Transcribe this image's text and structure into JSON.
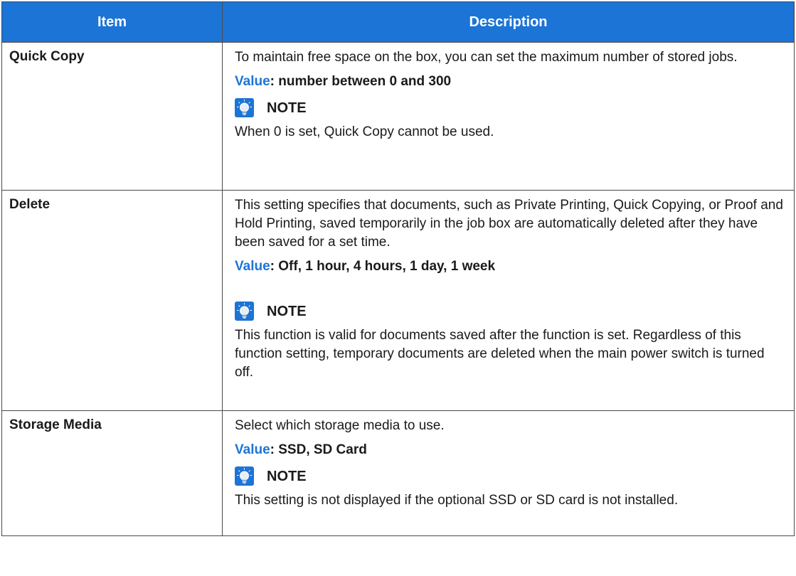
{
  "table": {
    "headers": {
      "item": "Item",
      "description": "Description"
    },
    "rows": [
      {
        "item": "Quick Copy",
        "description": "To maintain free space on the box, you can set the maximum number of stored jobs.",
        "value_key": "Value",
        "value_text": ": number between 0 and 300",
        "note_label": "NOTE",
        "note_text": "When 0 is set, Quick Copy cannot be used."
      },
      {
        "item": "Delete",
        "description": "This setting specifies that documents, such as Private Printing, Quick Copying, or Proof and Hold Printing, saved temporarily in the job box are automatically deleted after they have been saved for a set time.",
        "value_key": "Value",
        "value_text": ": Off, 1 hour, 4 hours, 1 day, 1 week",
        "note_label": "NOTE",
        "note_text": "This function is valid for documents saved after the function is set. Regardless of this function setting, temporary documents are deleted when the main power switch is turned off."
      },
      {
        "item": "Storage Media",
        "description": "Select which storage media to use.",
        "value_key": "Value",
        "value_text": ": SSD, SD Card",
        "note_label": "NOTE",
        "note_text": "This setting is not displayed if the optional SSD or SD card is not installed."
      }
    ]
  },
  "colors": {
    "header_bg": "#1c74d6",
    "value_key": "#1c74d6",
    "border": "#4a4a4a"
  },
  "icons": {
    "note": "lightbulb-note-icon"
  }
}
